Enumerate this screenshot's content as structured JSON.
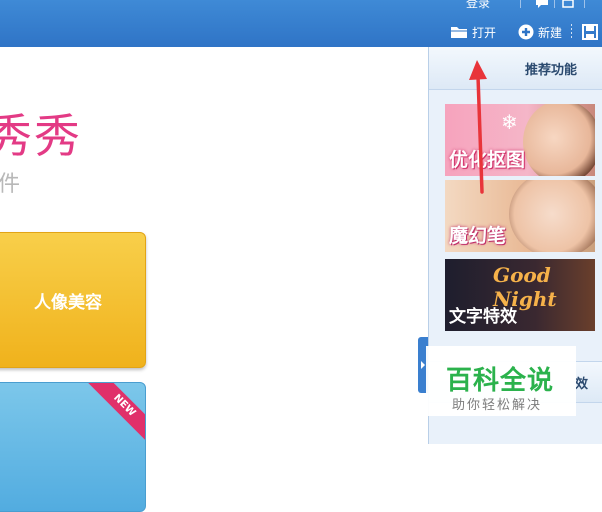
{
  "titlebar": {
    "login": "登录",
    "open_label": "打开",
    "new_label": "新建"
  },
  "brand": {
    "title": "秀秀",
    "subtitle": "件"
  },
  "main_buttons": {
    "portrait": "人像美容",
    "new_badge": "NEW"
  },
  "panel": {
    "title": "推荐功能",
    "features": [
      {
        "label": "优化抠图",
        "icon": "snowflake-icon"
      },
      {
        "label": "魔幻笔",
        "icon": "none"
      },
      {
        "label": "文字特效",
        "decor_text": "Good Night"
      }
    ],
    "section2_tail": "效"
  },
  "watermark": {
    "main": "百科全说",
    "sub": "助你轻松解决"
  },
  "colors": {
    "titlebar": "#2f74c6",
    "brand": "#e33a85",
    "portrait_button": "#f0b21c",
    "photo_button": "#52ace0",
    "arrow": "#e8343a",
    "watermark": "#2bb24c"
  }
}
